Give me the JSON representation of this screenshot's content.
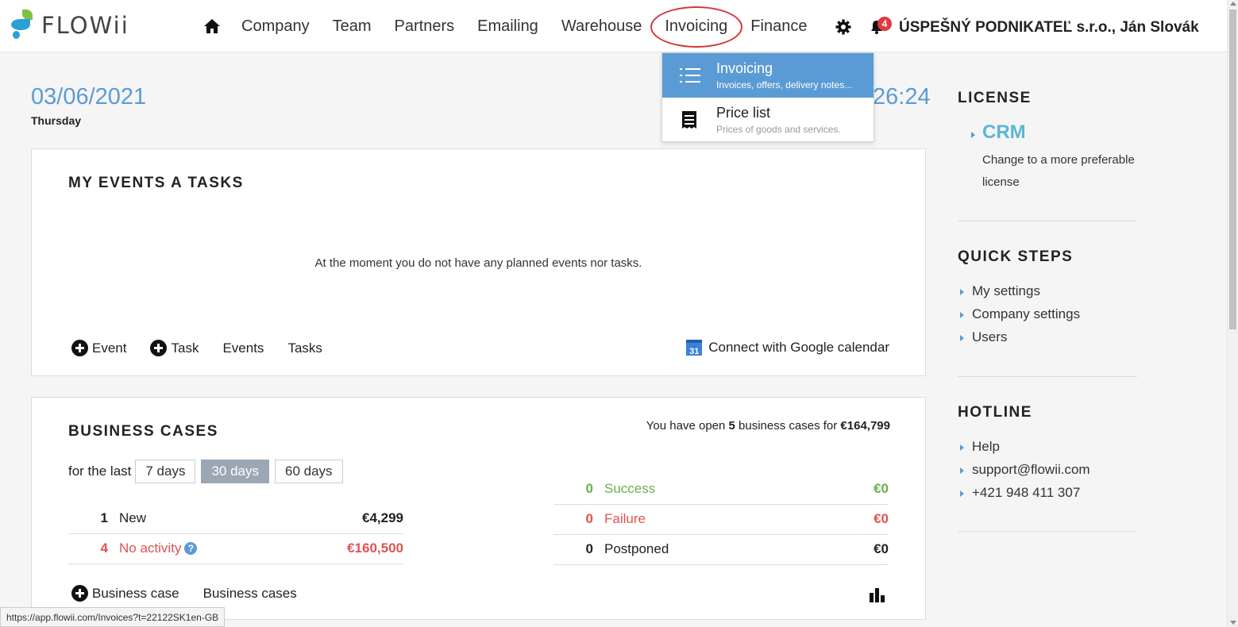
{
  "header": {
    "logo_text": "FLOWii",
    "nav": [
      "Company",
      "Team",
      "Partners",
      "Emailing",
      "Warehouse",
      "Invoicing",
      "Finance"
    ],
    "active_nav": "Invoicing",
    "notifications_count": "4",
    "company_user": "ÚSPEŠNÝ PODNIKATEĽ s.r.o., Ján Slovák",
    "icons": [
      "home-icon",
      "gear-icon",
      "bell-icon"
    ]
  },
  "dropdown": {
    "items": [
      {
        "title": "Invoicing",
        "subtitle": "Invoices, offers, delivery notes...",
        "icon": "list-icon",
        "selected": true
      },
      {
        "title": "Price list",
        "subtitle": "Prices of goods and services.",
        "icon": "receipt-icon",
        "selected": false
      }
    ]
  },
  "dashboard": {
    "date": "03/06/2021",
    "day": "Thursday",
    "time": "26:24"
  },
  "events": {
    "title": "MY EVENTS A TASKS",
    "empty_message": "At the moment you do not have any planned events nor tasks.",
    "add_event": "Event",
    "add_task": "Task",
    "events_link": "Events",
    "tasks_link": "Tasks",
    "google_calendar": "Connect with Google calendar",
    "gcal_icon_text": "31"
  },
  "cases": {
    "title": "BUSINESS CASES",
    "summary_prefix": "You have open ",
    "summary_count": "5",
    "summary_middle": " business cases for ",
    "summary_amount": "€164,799",
    "period_label": "for the last",
    "periods": [
      "7 days",
      "30 days",
      "60 days"
    ],
    "selected_period": "30 days",
    "left_rows": [
      {
        "count": "1",
        "label": "New",
        "amount": "€4,299",
        "color": "#222222"
      },
      {
        "count": "4",
        "label": "No activity",
        "amount": "€160,500",
        "color": "#e05353",
        "help": "?"
      }
    ],
    "right_rows": [
      {
        "count": "0",
        "label": "Success",
        "amount": "€0",
        "color": "#6ab04c"
      },
      {
        "count": "0",
        "label": "Failure",
        "amount": "€0",
        "color": "#e05353"
      },
      {
        "count": "0",
        "label": "Postponed",
        "amount": "€0",
        "color": "#222222"
      }
    ],
    "add_case": "Business case",
    "cases_link": "Business cases"
  },
  "sidebar": {
    "license": {
      "title": "LICENSE",
      "plan": "CRM",
      "description": "Change to a more preferable license"
    },
    "quick_steps": {
      "title": "QUICK STEPS",
      "links": [
        "My settings",
        "Company settings",
        "Users"
      ]
    },
    "hotline": {
      "title": "HOTLINE",
      "links": [
        "Help",
        "support@flowii.com",
        "+421 948 411 307"
      ]
    }
  },
  "status_bar": {
    "url": "https://app.flowii.com/Invoices?t=22122SK1en-GB"
  },
  "colors": {
    "accent": "#5b9bd5",
    "danger": "#e05353",
    "success": "#6ab04c",
    "highlight_circle": "#d23a3a"
  }
}
